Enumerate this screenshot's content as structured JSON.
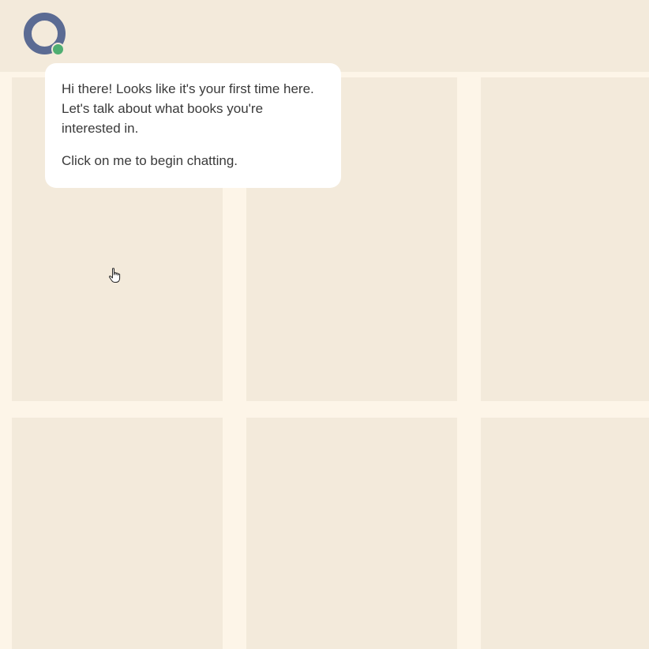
{
  "assistant": {
    "avatar_icon": "assistant-ring-icon",
    "status": "online",
    "status_color": "#4fae72",
    "ring_color": "#5b6b93"
  },
  "bubble": {
    "greeting": "Hi there! Looks like it's your first time here. Let's talk about what books you're interested in.",
    "call_to_action": "Click on me to begin chatting."
  },
  "colors": {
    "background": "#fdf5e8",
    "card": "#f3eadb",
    "bubble": "#ffffff",
    "text": "#3a3a3a"
  },
  "cursor": {
    "icon": "hand-pointer-icon"
  }
}
